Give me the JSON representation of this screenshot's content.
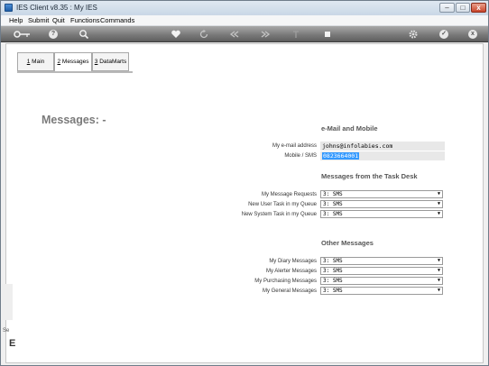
{
  "window": {
    "title": "IES Client v8.35 : My IES",
    "controls": {
      "minimize": "–",
      "maximize": "□",
      "close": "x"
    }
  },
  "menu": [
    "Help",
    "Submit",
    "Quit",
    "Functions",
    "Commands"
  ],
  "toolbar": {
    "icons": [
      "key-icon",
      "help-icon",
      "search-icon",
      "heart-icon",
      "refresh-icon",
      "rewind-icon",
      "fast-forward-icon",
      "upload-icon",
      "stop-icon",
      "settings-icon",
      "check-icon",
      "close-icon"
    ],
    "glyphs": {
      "help": "?",
      "check": "✓",
      "close": "x"
    }
  },
  "tabs": [
    {
      "hotkey": "1",
      "label": " Main",
      "active": false
    },
    {
      "hotkey": "2",
      "label": " Messages",
      "active": true
    },
    {
      "hotkey": "3",
      "label": " DataMarts",
      "active": false
    }
  ],
  "page": {
    "title": "Messages: -"
  },
  "email_section": {
    "title": "e-Mail and Mobile",
    "fields": [
      {
        "label": "My e-mail address",
        "value": "johns@infolabies.com",
        "selected": false
      },
      {
        "label": "Mobile / SMS",
        "value": "0823664001",
        "selected": true
      }
    ]
  },
  "task_desk_section": {
    "title": "Messages from the Task Desk",
    "fields": [
      {
        "label": "My Message Requests",
        "value": "3: SMS"
      },
      {
        "label": "New User Task in my Queue",
        "value": "3: SMS"
      },
      {
        "label": "New System Task in my Queue",
        "value": "3: SMS"
      }
    ]
  },
  "other_section": {
    "title": "Other Messages",
    "fields": [
      {
        "label": "My Diary Messages",
        "value": "3: SMS"
      },
      {
        "label": "My Alerter Messages",
        "value": "3: SMS"
      },
      {
        "label": "My Purchasing Messages",
        "value": "3: SMS"
      },
      {
        "label": "My General Messages",
        "value": "3: SMS"
      }
    ]
  },
  "left_stub": {
    "text": "Se",
    "glyph": "E"
  },
  "colors": {
    "toolbar": "#7b7b7b",
    "selection": "#3399ff",
    "field_bg": "#e8e8e8",
    "title_gray": "#7a7a7a"
  }
}
